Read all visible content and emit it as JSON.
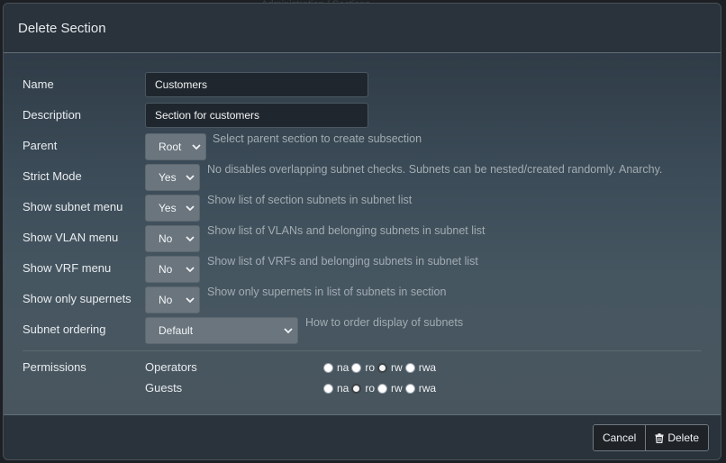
{
  "backdrop": {
    "hint": "Administration / Sections"
  },
  "modal": {
    "title": "Delete Section"
  },
  "fields": {
    "name": {
      "label": "Name",
      "value": "Customers"
    },
    "description": {
      "label": "Description",
      "value": "Section for customers"
    },
    "parent": {
      "label": "Parent",
      "value": "Root",
      "help": "Select parent section to create subsection"
    },
    "strict_mode": {
      "label": "Strict Mode",
      "value": "Yes",
      "help": "No disables overlapping subnet checks. Subnets can be nested/created randomly. Anarchy."
    },
    "show_subnet_menu": {
      "label": "Show subnet menu",
      "value": "Yes",
      "help": "Show list of section subnets in subnet list"
    },
    "show_vlan_menu": {
      "label": "Show VLAN menu",
      "value": "No",
      "help": "Show list of VLANs and belonging subnets in subnet list"
    },
    "show_vrf_menu": {
      "label": "Show VRF menu",
      "value": "No",
      "help": "Show list of VRFs and belonging subnets in subnet list"
    },
    "show_only_supernets": {
      "label": "Show only supernets",
      "value": "No",
      "help": "Show only supernets in list of subnets in section"
    },
    "subnet_ordering": {
      "label": "Subnet ordering",
      "value": "Default",
      "help": "How to order display of subnets"
    }
  },
  "permissions": {
    "label": "Permissions",
    "options": [
      "na",
      "ro",
      "rw",
      "rwa"
    ],
    "groups": [
      {
        "name": "Operators",
        "selected": "rw"
      },
      {
        "name": "Guests",
        "selected": "ro"
      }
    ]
  },
  "footer": {
    "cancel_label": "Cancel",
    "delete_label": "Delete"
  },
  "icons": {
    "chevron": "chevron-down-icon",
    "delete": "trash-icon"
  }
}
